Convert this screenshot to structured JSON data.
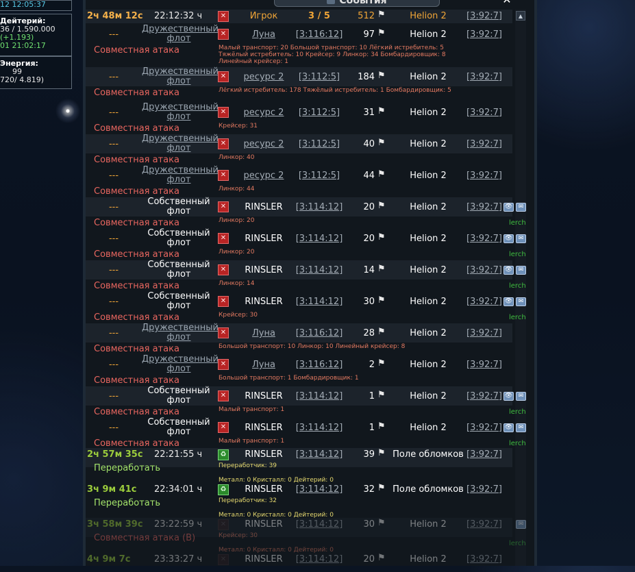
{
  "left_boxes": [
    {
      "lines": [
        "12 12:05:37"
      ]
    },
    {
      "title": "Дейтерий:",
      "lines": [
        "36 / 1.590.000",
        "(+1.193)",
        "01 21:02:17"
      ]
    },
    {
      "title": "Энергия:",
      "lines": [
        "99",
        "720/ 4.819)"
      ]
    }
  ],
  "window": {
    "title": "События",
    "close": "✕",
    "scroll_up": "▲"
  },
  "events": [
    {
      "time": "2ч 48м 12с",
      "clock": "22:12:32 ч",
      "origin": "Игрок",
      "ocoord": "3 / 5",
      "count": "512",
      "dest": "Helion 2",
      "dcoord": "[3:92:7]"
    },
    {
      "mission": "Дружественный флот",
      "origin": "Луна",
      "ocoord": "[3:116:12]",
      "count": "97",
      "dest": "Helion 2",
      "dcoord": "[3:92:7]",
      "label": "Совместная атака",
      "detail": "Малый транспорт: 20 Большой транспорт: 10 Лёгкий истребитель: 5 Тяжёлый истребитель: 10 Крейсер: 9 Линкор: 34 Бомбардировщик: 8 Линейный крейсер: 1"
    },
    {
      "mission": "Дружественный флот",
      "origin": "ресурс 2",
      "ocoord": "[3:112:5]",
      "count": "184",
      "dest": "Helion 2",
      "dcoord": "[3:92:7]",
      "label": "Совместная атака",
      "detail": "Лёгкий истребитель: 178 Тяжёлый истребитель: 1 Бомбардировщик: 5"
    },
    {
      "mission": "Дружественный флот",
      "origin": "ресурс 2",
      "ocoord": "[3:112:5]",
      "count": "31",
      "dest": "Helion 2",
      "dcoord": "[3:92:7]",
      "label": "Совместная атака",
      "detail": "Крейсер: 31"
    },
    {
      "mission": "Дружественный флот",
      "origin": "ресурс 2",
      "ocoord": "[3:112:5]",
      "count": "40",
      "dest": "Helion 2",
      "dcoord": "[3:92:7]",
      "label": "Совместная атака",
      "detail": "Линкор: 40"
    },
    {
      "mission": "Дружественный флот",
      "origin": "ресурс 2",
      "ocoord": "[3:112:5]",
      "count": "44",
      "dest": "Helion 2",
      "dcoord": "[3:92:7]",
      "label": "Совместная атака",
      "detail": "Линкор: 44"
    },
    {
      "mission": "Собственный флот",
      "origin": "RINSLER",
      "ocoord": "[3:114:12]",
      "count": "20",
      "dest": "Helion 2",
      "dcoord": "[3:92:7]",
      "label": "Совместная атака",
      "detail": "Линкор: 20",
      "owner": "lerch"
    },
    {
      "mission": "Собственный флот",
      "origin": "RINSLER",
      "ocoord": "[3:114:12]",
      "count": "20",
      "dest": "Helion 2",
      "dcoord": "[3:92:7]",
      "label": "Совместная атака",
      "detail": "Линкор: 20",
      "owner": "lerch"
    },
    {
      "mission": "Собственный флот",
      "origin": "RINSLER",
      "ocoord": "[3:114:12]",
      "count": "14",
      "dest": "Helion 2",
      "dcoord": "[3:92:7]",
      "label": "Совместная атака",
      "detail": "Линкор: 14",
      "owner": "lerch"
    },
    {
      "mission": "Собственный флот",
      "origin": "RINSLER",
      "ocoord": "[3:114:12]",
      "count": "30",
      "dest": "Helion 2",
      "dcoord": "[3:92:7]",
      "label": "Совместная атака",
      "detail": "Крейсер: 30",
      "owner": "lerch"
    },
    {
      "mission": "Дружественный флот",
      "origin": "Луна",
      "ocoord": "[3:116:12]",
      "count": "28",
      "dest": "Helion 2",
      "dcoord": "[3:92:7]",
      "label": "Совместная атака",
      "detail": "Большой транспорт: 10 Линкор: 10 Линейный крейсер: 8"
    },
    {
      "mission": "Дружественный флот",
      "origin": "Луна",
      "ocoord": "[3:116:12]",
      "count": "2",
      "dest": "Helion 2",
      "dcoord": "[3:92:7]",
      "label": "Совместная атака",
      "detail": "Большой транспорт: 1 Бомбардировщик: 1"
    },
    {
      "mission": "Собственный флот",
      "origin": "RINSLER",
      "ocoord": "[3:114:12]",
      "count": "1",
      "dest": "Helion 2",
      "dcoord": "[3:92:7]",
      "label": "Совместная атака",
      "detail": "Малый транспорт: 1",
      "owner": "lerch"
    },
    {
      "mission": "Собственный флот",
      "origin": "RINSLER",
      "ocoord": "[3:114:12]",
      "count": "1",
      "dest": "Helion 2",
      "dcoord": "[3:92:7]",
      "label": "Совместная атака",
      "detail": "Малый транспорт: 1",
      "owner": "lerch"
    },
    {
      "time": "2ч 57м 35с",
      "clock": "22:21:55 ч",
      "origin": "RINSLER",
      "ocoord": "[3:114:12]",
      "count": "39",
      "dest": "Поле обломков",
      "dcoord": "[3:92:7]",
      "label": "Переработать",
      "detail": "Переработчик: 39",
      "detail2": "Металл: 0 Кристалл: 0 Дейтерий: 0"
    },
    {
      "time": "3ч 9м 41с",
      "clock": "22:34:01 ч",
      "origin": "RINSLER",
      "ocoord": "[3:114:12]",
      "count": "32",
      "dest": "Поле обломков",
      "dcoord": "[3:92:7]",
      "label": "Переработать",
      "detail": "Переработчик: 32",
      "detail2": "Металл: 0 Кристалл: 0 Дейтерий: 0"
    },
    {
      "time": "3ч 58м 39с",
      "clock": "23:22:59 ч",
      "origin": "RINSLER",
      "ocoord": "[3:114:12]",
      "count": "30",
      "dest": "Helion 2",
      "dcoord": "[3:92:7]",
      "label": "Совместная атака (В)",
      "detail": "Крейсер: 30",
      "detail2": "Металл: 0 Кристалл: 0 Дейтерий: 0",
      "owner": "lerch"
    },
    {
      "time": "4ч 9м 7с",
      "clock": "23:33:27 ч",
      "origin": "RINSLER",
      "ocoord": "[3:114:12]",
      "count": "20",
      "dest": "Helion 2",
      "dcoord": "[3:92:7]"
    }
  ],
  "mission_dash": "---",
  "icons": {
    "fleet": "crossed-swords-icon",
    "recycle": "recycler-icon",
    "flag": "flag-icon",
    "eye": "eye-icon",
    "mail": "mail-icon"
  }
}
